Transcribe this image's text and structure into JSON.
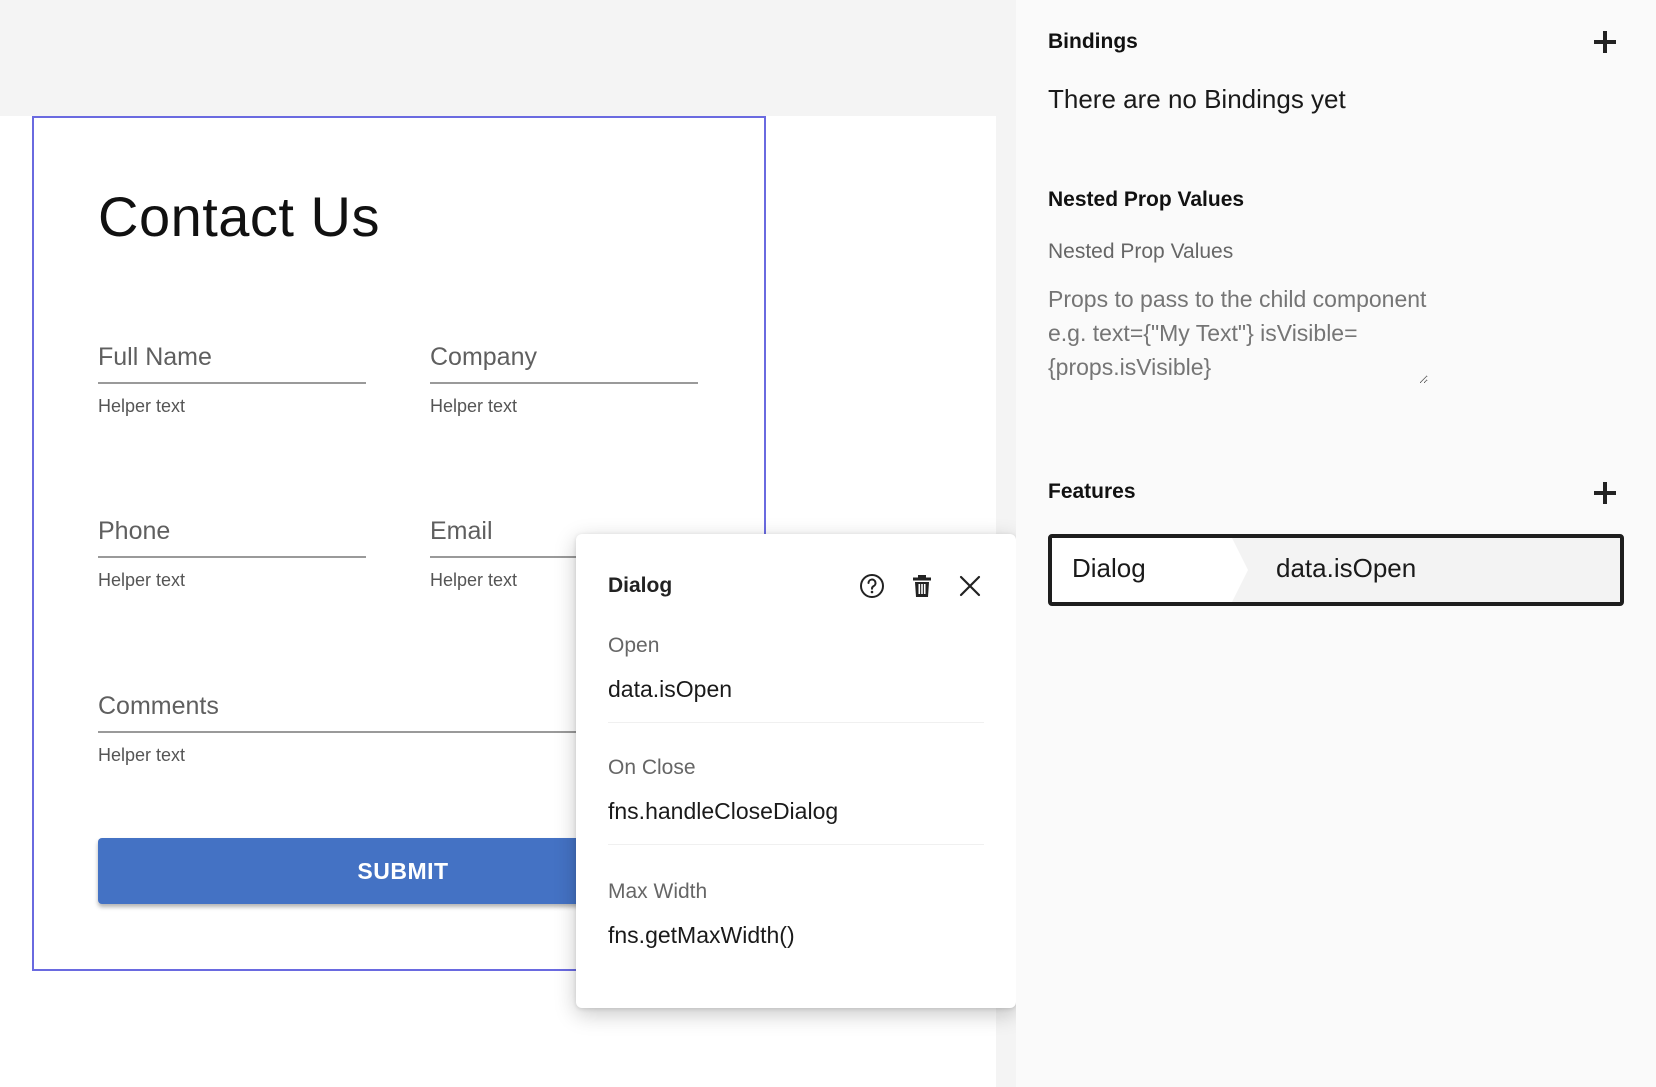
{
  "form": {
    "title": "Contact Us",
    "fields": [
      {
        "label": "Full Name",
        "helper": "Helper text"
      },
      {
        "label": "Company",
        "helper": "Helper text"
      },
      {
        "label": "Phone",
        "helper": "Helper text"
      },
      {
        "label": "Email",
        "helper": "Helper text"
      },
      {
        "label": "Comments",
        "helper": "Helper text"
      }
    ],
    "submit_label": "SUBMIT"
  },
  "dialog_popover": {
    "title": "Dialog",
    "icons": [
      "help-icon",
      "trash-icon",
      "close-icon"
    ],
    "props": [
      {
        "label": "Open",
        "value": "data.isOpen"
      },
      {
        "label": "On Close",
        "value": "fns.handleCloseDialog"
      },
      {
        "label": "Max Width",
        "value": "fns.getMaxWidth()"
      }
    ]
  },
  "panel": {
    "bindings": {
      "title": "Bindings",
      "empty_text": "There are no Bindings yet"
    },
    "nested_props": {
      "title": "Nested Prop Values",
      "label": "Nested Prop Values",
      "placeholder": "Props to pass to the child component e.g. text={\"My Text\"} isVisible={props.isVisible}"
    },
    "features": {
      "title": "Features",
      "items": [
        {
          "name": "Dialog",
          "value": "data.isOpen"
        }
      ]
    }
  },
  "colors": {
    "accent_border": "#6a6ae0",
    "submit_button": "#4472c4"
  }
}
